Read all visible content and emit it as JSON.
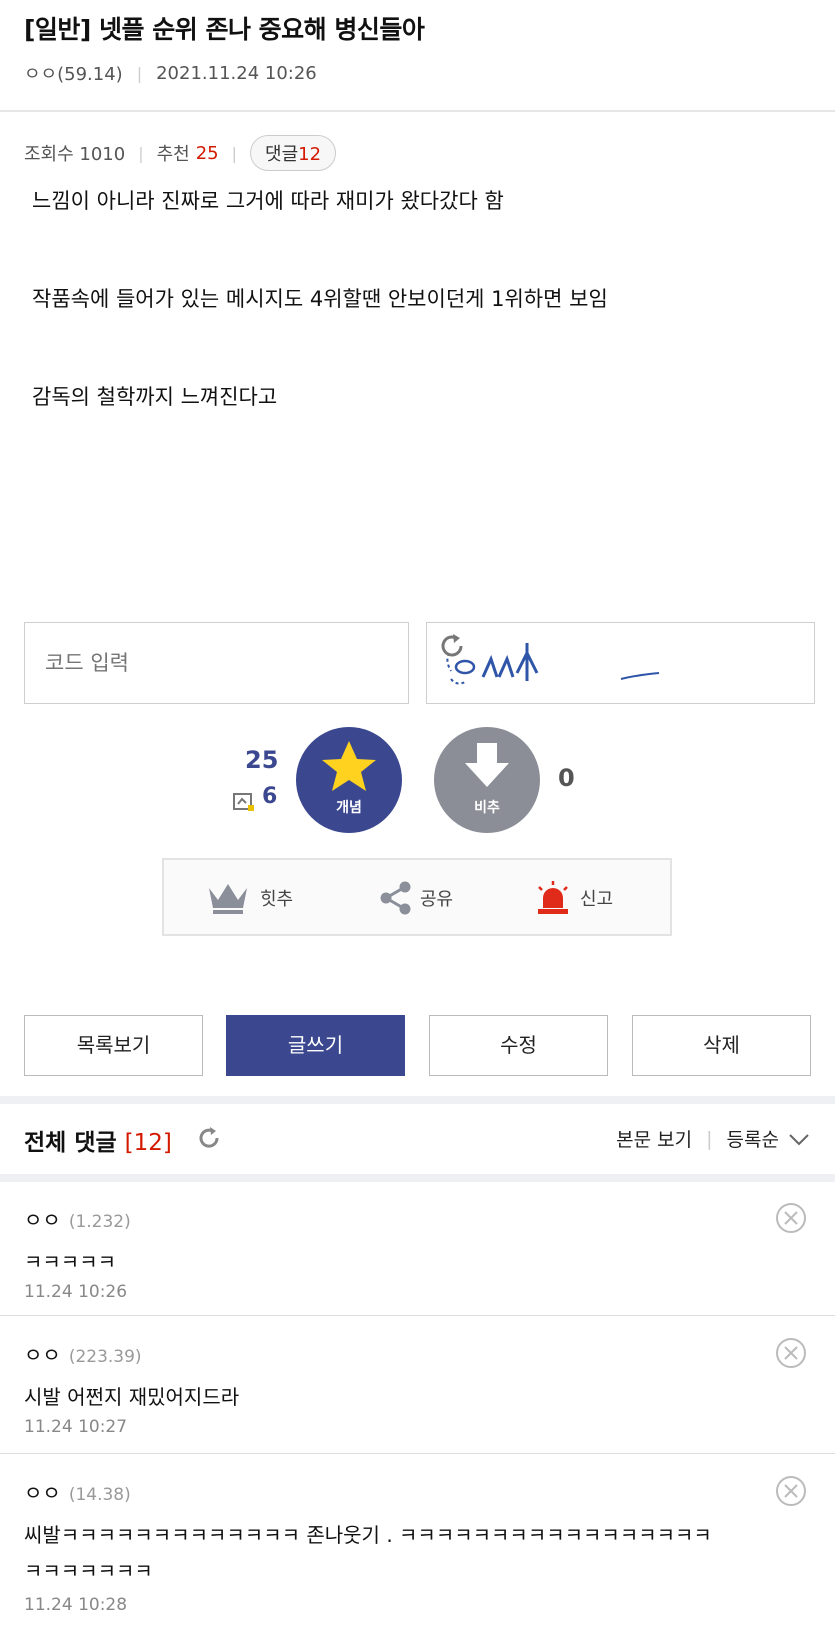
{
  "post": {
    "title": "[일반] 넷플 순위 존나 중요해 병신들아",
    "author": "ㅇㅇ(59.14)",
    "date": "2021.11.24 10:26",
    "views_label": "조회수 1010",
    "recommend_label": "추천",
    "recommend_count": "25",
    "comment_label": "댓글",
    "comment_count": "12",
    "body": [
      "느낌이 아니라 진짜로 그거에 따라 재미가 왔다갔다 함",
      "작품속에 들어가 있는 메시지도 4위할땐 안보이던게 1위하면 보임",
      "감독의 철학까지 느껴진다고"
    ]
  },
  "captcha": {
    "placeholder": "코드 입력"
  },
  "vote": {
    "up_count": "25",
    "fix_count": "6",
    "up_label": "개념",
    "down_label": "비추",
    "down_count": "0"
  },
  "actions": {
    "hit": "힛추",
    "share": "공유",
    "report": "신고"
  },
  "buttons": {
    "list": "목록보기",
    "write": "글쓰기",
    "edit": "수정",
    "delete": "삭제"
  },
  "comments_header": {
    "title": "전체 댓글",
    "count": "[12]",
    "view_body": "본문 보기",
    "sort": "등록순"
  },
  "comments": [
    {
      "author": "ㅇㅇ",
      "ip": "(1.232)",
      "text": "ㅋㅋㅋㅋㅋ",
      "text2": "",
      "time": "11.24 10:26"
    },
    {
      "author": "ㅇㅇ",
      "ip": "(223.39)",
      "text": "시발 어쩐지 재밌어지드라",
      "text2": "",
      "time": "11.24 10:27"
    },
    {
      "author": "ㅇㅇ",
      "ip": "(14.38)",
      "text": "씨발ㅋㅋㅋㅋㅋㅋㅋㅋㅋㅋㅋㅋㅋ 존나웃기 . ㅋㅋㅋㅋㅋㅋㅋㅋㅋㅋㅋㅋㅋㅋㅋㅋㅋ",
      "text2": "ㅋㅋㅋㅋㅋㅋㅋ",
      "time": "11.24 10:28"
    }
  ],
  "colors": {
    "brand": "#3b4890",
    "accent_red": "#d31900",
    "down_gray": "#8b8e96"
  },
  "icons": [
    "refresh-icon",
    "star-icon",
    "down-arrow-icon",
    "crown-icon",
    "share-icon",
    "siren-icon",
    "chevron-down-icon",
    "delete-circle-icon",
    "fix-icon"
  ]
}
